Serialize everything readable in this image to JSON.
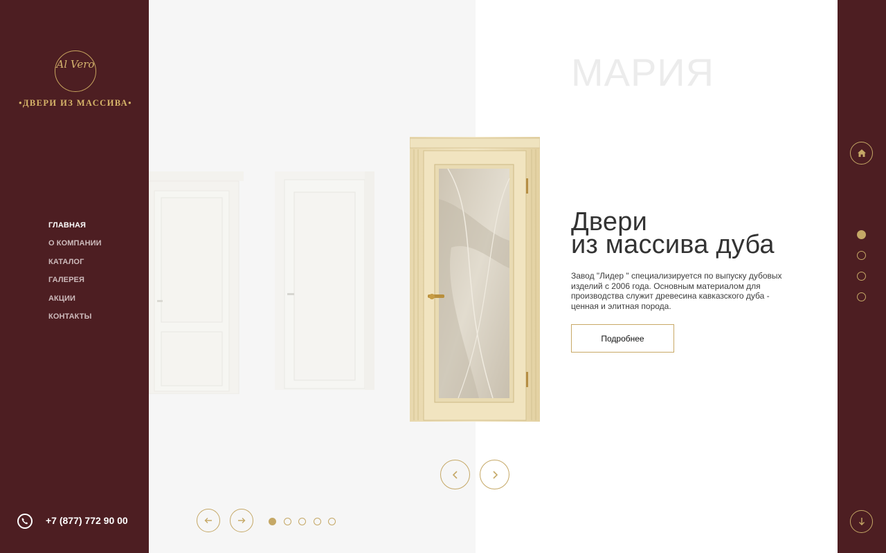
{
  "brand": {
    "logo_monogram": "Al Vero",
    "logo_text": "•ДВЕРИ ИЗ МАССИВА•"
  },
  "nav": {
    "items": [
      {
        "label": "ГЛАВНАЯ",
        "active": true
      },
      {
        "label": "О КОМПАНИИ",
        "active": false
      },
      {
        "label": "КАТАЛОГ",
        "active": false
      },
      {
        "label": "ГАЛЕРЕЯ",
        "active": false
      },
      {
        "label": "АКЦИИ",
        "active": false
      },
      {
        "label": "КОНТАКТЫ",
        "active": false
      }
    ]
  },
  "contact": {
    "phone": "+7 (877) 772 90 00",
    "phone_icon": "phone-icon"
  },
  "hero": {
    "watermark": "МАРИЯ",
    "title_line1": "Двери",
    "title_line2": "из массива дуба",
    "description": "Завод \"Лидер \" специализируется по выпуску дубовых изделий с 2006 года. Основным материалом для производства служит древесина кавказского дуба - ценная и элитная порода.",
    "more_button": "Подробнее"
  },
  "slider": {
    "dots_total": 5,
    "active_dot": 1,
    "door_slides": 3,
    "active_door": 3
  },
  "section_nav": {
    "total": 4,
    "active": 1
  },
  "colors": {
    "sidebar": "#4d1e22",
    "accent": "#c5a866",
    "grey_panel": "#f6f6f6"
  }
}
